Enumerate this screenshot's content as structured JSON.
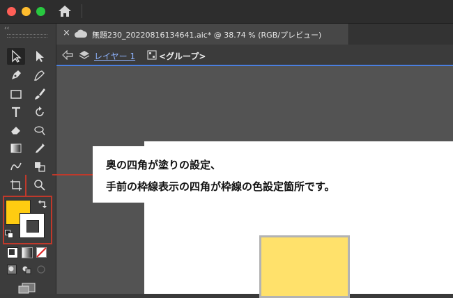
{
  "window": {
    "traffic_lights": [
      "#ff5f57",
      "#febc2e",
      "#28c840"
    ]
  },
  "toolbar": {
    "collapse_label": "‹‹"
  },
  "tab": {
    "close_label": "×",
    "title": "無題230_20220816134641.aic* @ 38.74 % (RGB/プレビュー)"
  },
  "breadcrumb": {
    "layer_name": "レイヤー 1",
    "group_name": "<グループ>"
  },
  "colors": {
    "fill": "#ffcc11",
    "stroke": "#ffffff",
    "accent": "#4a7fe0",
    "annotation": "#c0392b",
    "art_fill": "#ffe16b",
    "art_stroke": "#b3b3b3"
  },
  "annotation": {
    "line1": "奥の四角が塗りの設定、",
    "line2": "手前の枠線表示の四角が枠線の色設定箇所です。"
  }
}
